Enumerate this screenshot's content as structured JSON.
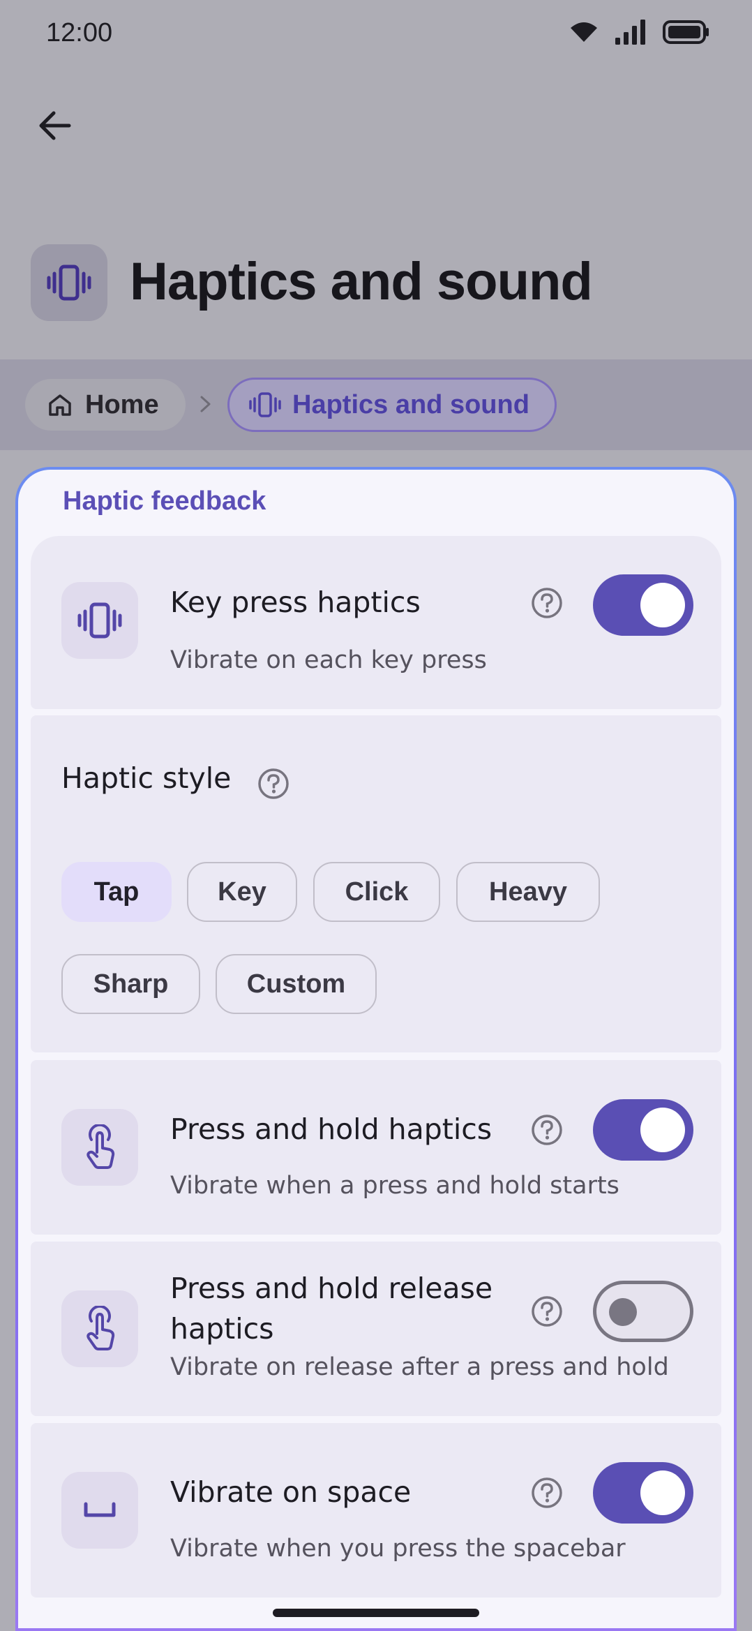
{
  "status_bar": {
    "time": "12:00",
    "icons": [
      "wifi-icon",
      "signal-icon",
      "battery-icon"
    ]
  },
  "header": {
    "back_icon": "arrow-left-icon",
    "icon": "vibration-icon",
    "title": "Haptics and sound"
  },
  "breadcrumb": {
    "items": [
      {
        "label": "Home",
        "icon": "home-icon"
      },
      {
        "label": "Haptics and sound",
        "icon": "vibration-icon"
      }
    ],
    "separator_icon": "chevron-right-icon"
  },
  "section": {
    "title": "Haptic feedback",
    "rows": [
      {
        "title": "Key press haptics",
        "subtitle": "Vibrate on each key press",
        "icon": "vibration-icon",
        "enabled": true
      },
      {
        "title": "Press and hold haptics",
        "subtitle": "Vibrate when a press and hold starts",
        "icon": "touch-hand-icon",
        "enabled": true
      },
      {
        "title": "Press and hold release haptics",
        "subtitle": "Vibrate on release after a press and hold",
        "icon": "touch-hand-icon",
        "enabled": false
      },
      {
        "title": "Vibrate on space",
        "subtitle": "Vibrate when you press the spacebar",
        "icon": "spacebar-icon",
        "enabled": true
      }
    ],
    "haptic_style": {
      "label": "Haptic style",
      "options": [
        "Tap",
        "Key",
        "Click",
        "Heavy",
        "Sharp",
        "Custom"
      ],
      "selected": "Tap"
    }
  },
  "colors": {
    "accent": "#5a4fb4",
    "accent_text": "#5b4fb6",
    "card": "#ebe9f4"
  }
}
